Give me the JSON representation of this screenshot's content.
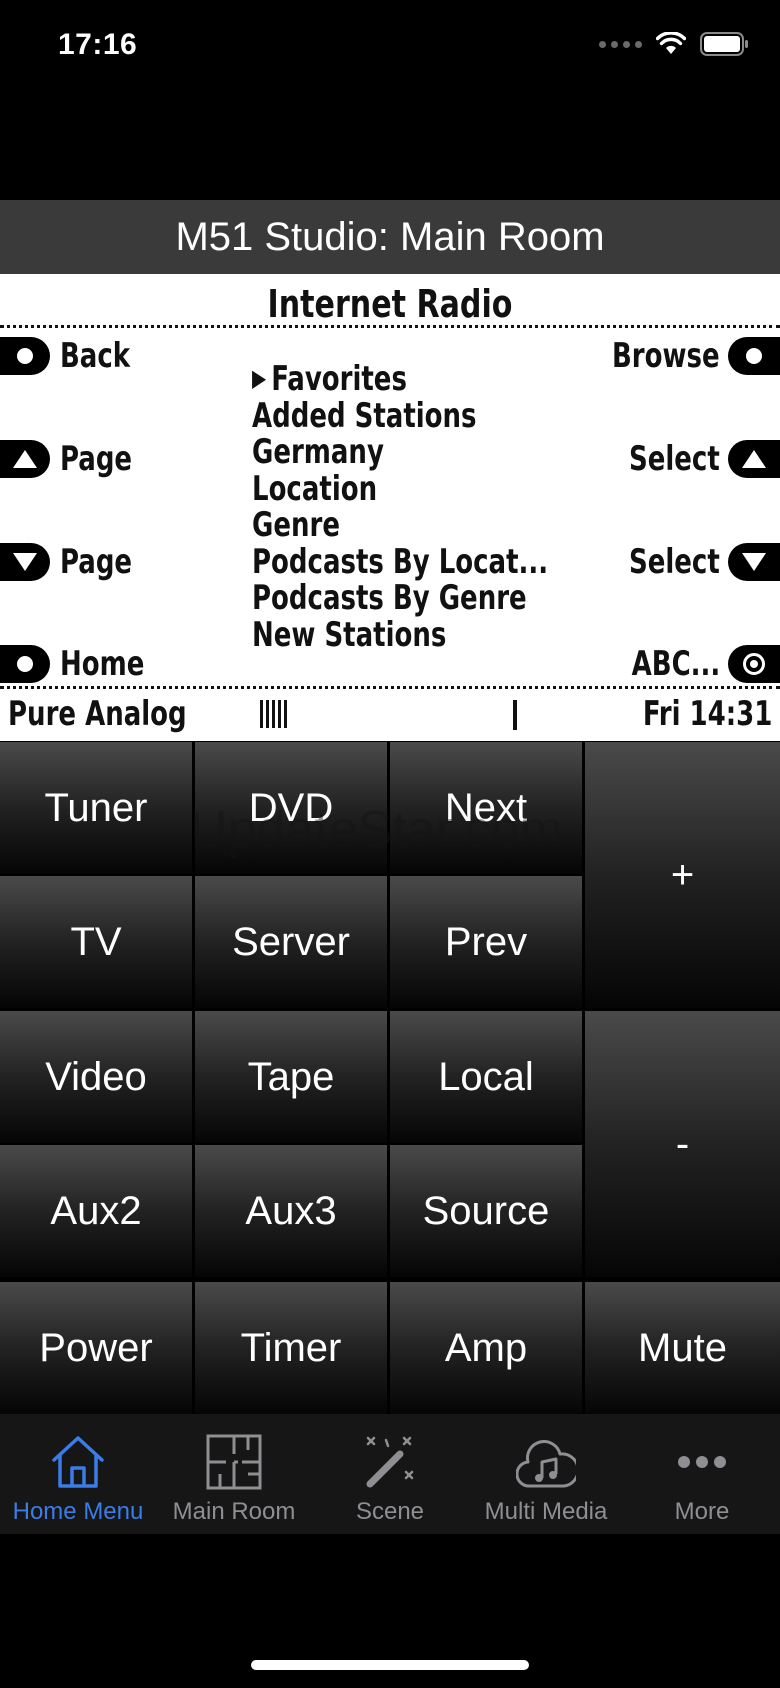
{
  "status": {
    "time": "17:16"
  },
  "title": "M51 Studio: Main Room",
  "lcd": {
    "header": "Internet Radio",
    "left_buttons": [
      "Back",
      "Page",
      "Page",
      "Home"
    ],
    "right_buttons": [
      "Browse",
      "Select",
      "Select",
      "ABC..."
    ],
    "menu_items": [
      "Favorites",
      "Added Stations",
      "Germany",
      "Location",
      "Genre",
      "Podcasts By Locat...",
      "Podcasts By Genre",
      "New Stations"
    ],
    "selected_marker": "▶",
    "footer_left": "Pure Analog",
    "footer_right": "Fri 14:31"
  },
  "keys": {
    "tuner": "Tuner",
    "dvd": "DVD",
    "next": "Next",
    "plus": "+",
    "tv": "TV",
    "server": "Server",
    "prev": "Prev",
    "video": "Video",
    "tape": "Tape",
    "local": "Local",
    "minus": "-",
    "aux2": "Aux2",
    "aux3": "Aux3",
    "source": "Source",
    "power": "Power",
    "timer": "Timer",
    "amp": "Amp",
    "mute": "Mute"
  },
  "watermark": "UpdateStar.com",
  "tabs": [
    "Home Menu",
    "Main Room",
    "Scene",
    "Multi Media",
    "More"
  ],
  "colors": {
    "active_tab": "#3a7ce8",
    "inactive_tab": "#8e8e93",
    "title_bar": "#3a3a3a"
  }
}
